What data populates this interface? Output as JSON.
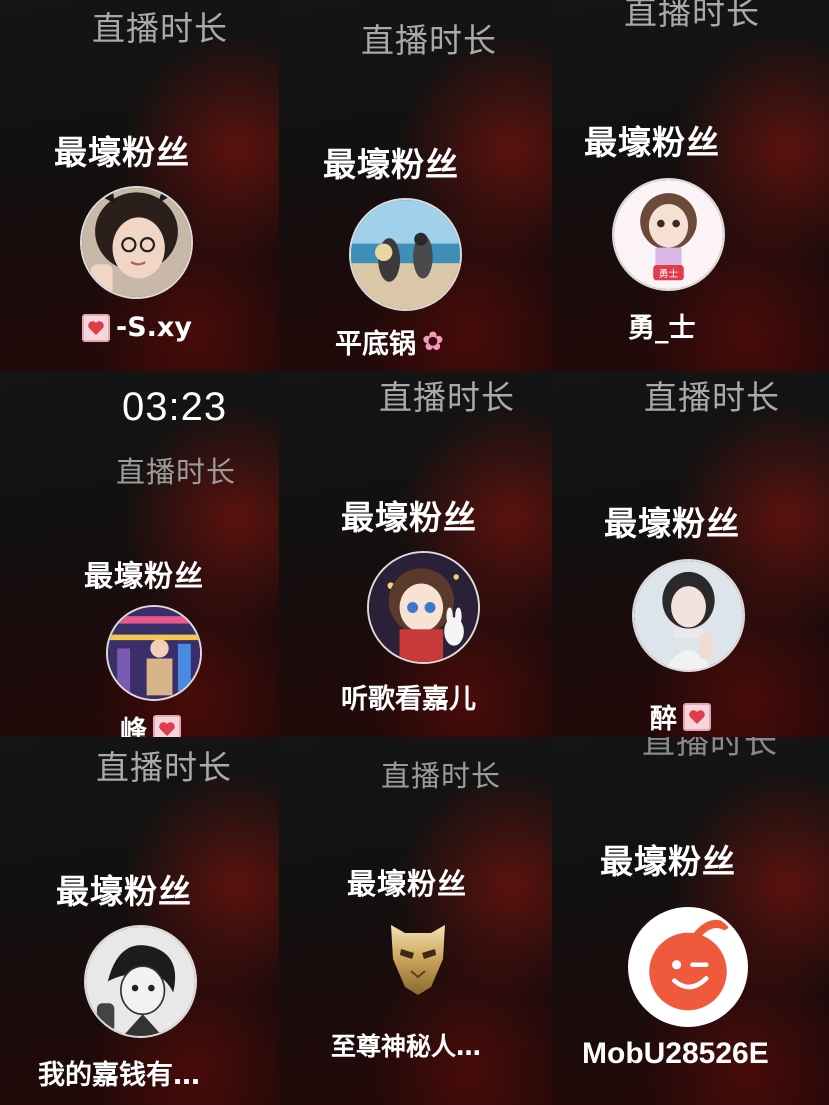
{
  "cells": [
    {
      "duration_label": "直播时长",
      "fan_label": "最壕粉丝",
      "name": "-S.xy",
      "name_badge": "heart-badge-icon"
    },
    {
      "duration_label": "直播时长",
      "fan_label": "最壕粉丝",
      "name": "平底锅",
      "name_badge": "cherry-blossom-icon"
    },
    {
      "duration_label": "直播时长",
      "fan_label": "最壕粉丝",
      "name": "勇_士"
    },
    {
      "timer": "03:23",
      "duration_label": "直播时长",
      "fan_label": "最壕粉丝",
      "name": "峰",
      "name_badge": "heart-badge-icon"
    },
    {
      "duration_label": "直播时长",
      "fan_label": "最壕粉丝",
      "name": "听歌看嘉儿"
    },
    {
      "duration_label": "直播时长",
      "fan_label": "最壕粉丝",
      "name": "醉",
      "name_badge": "heart-badge-icon"
    },
    {
      "duration_label": "直播时长",
      "fan_label": "最壕粉丝",
      "name": "我的嘉钱有…"
    },
    {
      "duration_label": "直播时长",
      "fan_label": "最壕粉丝",
      "name": "至尊神秘人…"
    },
    {
      "duration_label": "直播时长",
      "fan_label": "最壕粉丝",
      "name": "MobU28526E"
    }
  ],
  "colors": {
    "background": "#0b0b0b",
    "accent_red": "#96140c",
    "label_gray": "#a9a9a9",
    "text_white": "#ffffff"
  }
}
